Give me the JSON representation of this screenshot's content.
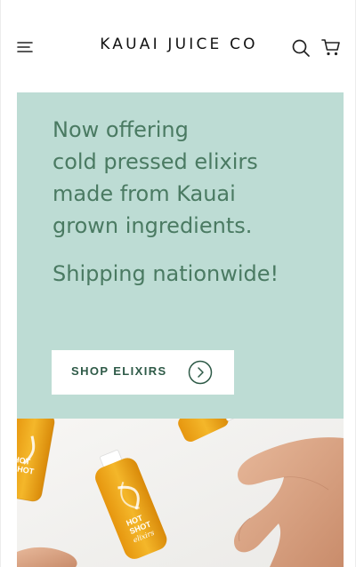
{
  "header": {
    "brand": "KAUAI JUICE CO",
    "menu_icon": "hamburger-menu-icon",
    "search_icon": "search-icon",
    "cart_icon": "shopping-cart-icon"
  },
  "hero": {
    "headline_lines": [
      "Now offering",
      "cold pressed elixirs",
      "made from Kauai",
      "grown ingredients."
    ],
    "subheadline": "Shipping nationwide!",
    "cta_label": "SHOP ELIXIRS",
    "cta_icon": "arrow-right-circle-icon",
    "background": "#bddcd4",
    "text_color": "#4a7a62"
  },
  "product_image": {
    "bottle_label_lines": [
      "HOT",
      "SHOT"
    ],
    "bottle_label_script": "elixirs"
  }
}
